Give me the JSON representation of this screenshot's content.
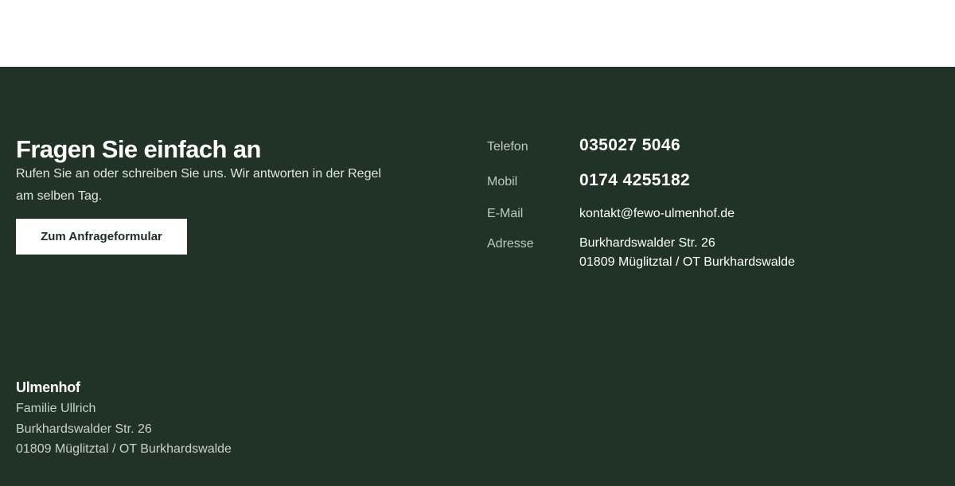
{
  "cta": {
    "title": "Fragen Sie einfach an",
    "text": "Rufen Sie an oder schreiben Sie uns. Wir antworten in der Regel am selben Tag.",
    "button_label": "Zum Anfrageformular"
  },
  "contact": {
    "phone_label": "Telefon",
    "phone_value": "035027 5046",
    "mobile_label": "Mobil",
    "mobile_value": "0174 4255182",
    "email_label": "E-Mail",
    "email_value": "kontakt@fewo-ulmenhof.de",
    "address_label": "Adresse",
    "address_line1": "Burkhardswalder Str. 26",
    "address_line2": "01809 Müglitztal / OT Burkhardswalde"
  },
  "imprint": {
    "name": "Ulmenhof",
    "owner": "Familie Ullrich",
    "street": "Burkhardswalder Str. 26",
    "city": "01809 Müglitztal / OT Burkhardswalde"
  },
  "colors": {
    "footer_bg": "#203326",
    "button_bg": "#ffffff",
    "label_text": "#bfc9c1"
  }
}
